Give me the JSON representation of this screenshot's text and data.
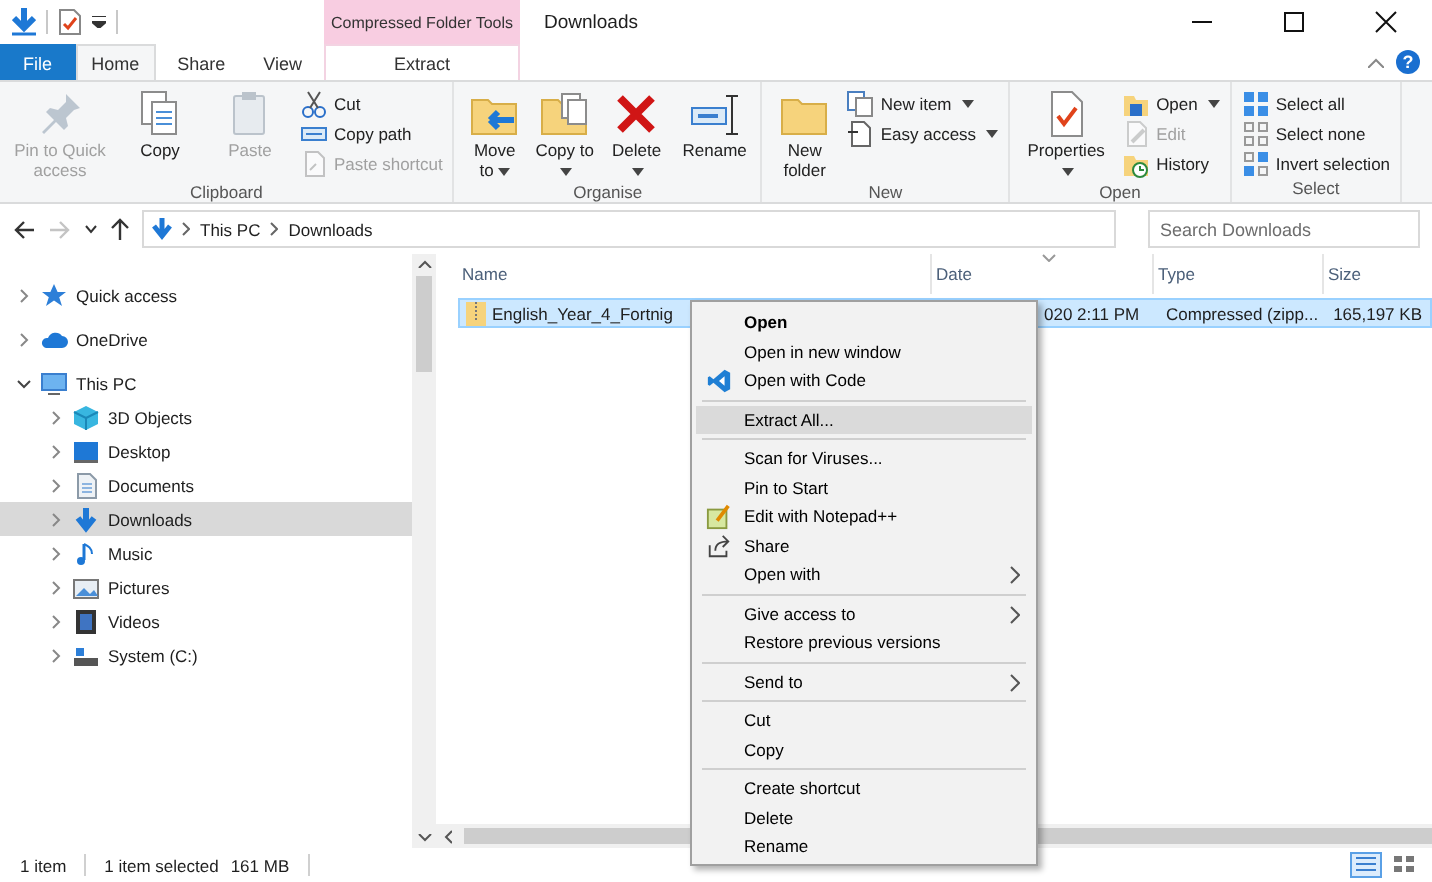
{
  "window": {
    "title": "Downloads",
    "tool_group": "Compressed Folder Tools"
  },
  "ribbon_tabs": [
    {
      "label": "File",
      "kind": "file",
      "selected": false
    },
    {
      "label": "Home",
      "kind": "normal",
      "selected": true
    },
    {
      "label": "Share",
      "kind": "normal",
      "selected": false
    },
    {
      "label": "View",
      "kind": "normal",
      "selected": false
    },
    {
      "label": "Extract",
      "kind": "contextual",
      "selected": false
    }
  ],
  "help_button": "?",
  "ribbon_groups": [
    {
      "label": "Clipboard",
      "buttons": [
        {
          "label": "Pin to Quick access",
          "kind": "large",
          "dropdown": false,
          "disabled": true
        },
        {
          "label": "Copy",
          "kind": "large",
          "dropdown": false,
          "disabled": false
        },
        {
          "label": "Paste",
          "kind": "large",
          "dropdown": false,
          "disabled": true
        },
        {
          "label": "Cut",
          "kind": "small",
          "dropdown": false,
          "disabled": false
        },
        {
          "label": "Copy path",
          "kind": "small",
          "dropdown": false,
          "disabled": false
        },
        {
          "label": "Paste shortcut",
          "kind": "small",
          "dropdown": false,
          "disabled": true
        }
      ]
    },
    {
      "label": "Organise",
      "buttons": [
        {
          "label": "Move to",
          "kind": "large",
          "dropdown": true,
          "disabled": false
        },
        {
          "label": "Copy to",
          "kind": "large",
          "dropdown": true,
          "disabled": false
        },
        {
          "label": "Delete",
          "kind": "large",
          "dropdown": true,
          "disabled": false
        },
        {
          "label": "Rename",
          "kind": "large",
          "dropdown": false,
          "disabled": false
        }
      ]
    },
    {
      "label": "New",
      "buttons": [
        {
          "label": "New folder",
          "kind": "large",
          "dropdown": false,
          "disabled": false
        },
        {
          "label": "New item",
          "kind": "small",
          "dropdown": true,
          "disabled": false
        },
        {
          "label": "Easy access",
          "kind": "small",
          "dropdown": true,
          "disabled": false
        }
      ]
    },
    {
      "label": "Open",
      "buttons": [
        {
          "label": "Properties",
          "kind": "large",
          "dropdown": true,
          "disabled": false
        },
        {
          "label": "Open",
          "kind": "small",
          "dropdown": true,
          "disabled": false
        },
        {
          "label": "Edit",
          "kind": "small",
          "dropdown": false,
          "disabled": true
        },
        {
          "label": "History",
          "kind": "small",
          "dropdown": false,
          "disabled": false
        }
      ]
    },
    {
      "label": "Select",
      "buttons": [
        {
          "label": "Select all",
          "kind": "small",
          "dropdown": false,
          "disabled": false
        },
        {
          "label": "Select none",
          "kind": "small",
          "dropdown": false,
          "disabled": false
        },
        {
          "label": "Invert selection",
          "kind": "small",
          "dropdown": false,
          "disabled": false
        }
      ]
    }
  ],
  "history_buttons": [
    {
      "disabled": false
    },
    {
      "disabled": true
    },
    {
      "disabled": false
    },
    {
      "disabled": false
    }
  ],
  "address_bar": {
    "path": [
      "This PC",
      "Downloads"
    ]
  },
  "search": {
    "placeholder": "Search Downloads"
  },
  "navigation_pane": {
    "items": [
      {
        "label": "Quick access",
        "expanded": false,
        "selected": false
      },
      {
        "label": "OneDrive",
        "expanded": false,
        "selected": false
      },
      {
        "label": "This PC",
        "expanded": true,
        "selected": false,
        "children": [
          {
            "label": "3D Objects",
            "expanded": false,
            "selected": false
          },
          {
            "label": "Desktop",
            "expanded": false,
            "selected": false
          },
          {
            "label": "Documents",
            "expanded": false,
            "selected": false
          },
          {
            "label": "Downloads",
            "expanded": false,
            "selected": true
          },
          {
            "label": "Music",
            "expanded": false,
            "selected": false
          },
          {
            "label": "Pictures",
            "expanded": false,
            "selected": false
          },
          {
            "label": "Videos",
            "expanded": false,
            "selected": false
          },
          {
            "label": "System (C:)",
            "expanded": false,
            "selected": false
          }
        ]
      }
    ]
  },
  "file_list": {
    "columns": [
      "Name",
      "Date",
      "Type",
      "Size"
    ],
    "rows": [
      {
        "name": "English_Year_4_Fortnig",
        "date": "020 2:11 PM",
        "type": "Compressed (zipp...",
        "size": "165,197 KB",
        "selected": true
      }
    ]
  },
  "context_menu": {
    "items": [
      {
        "kind": "item",
        "label": "Open",
        "default": true,
        "highlighted": false,
        "submenu": false
      },
      {
        "kind": "item",
        "label": "Open in new window",
        "default": false,
        "highlighted": false,
        "submenu": false
      },
      {
        "kind": "item",
        "label": "Open with Code",
        "default": false,
        "highlighted": false,
        "submenu": false
      },
      {
        "kind": "separator"
      },
      {
        "kind": "item",
        "label": "Extract All...",
        "default": false,
        "highlighted": true,
        "submenu": false
      },
      {
        "kind": "separator"
      },
      {
        "kind": "item",
        "label": "Scan for Viruses...",
        "default": false,
        "highlighted": false,
        "submenu": false
      },
      {
        "kind": "item",
        "label": "Pin to Start",
        "default": false,
        "highlighted": false,
        "submenu": false
      },
      {
        "kind": "item",
        "label": "Edit with Notepad++",
        "default": false,
        "highlighted": false,
        "submenu": false
      },
      {
        "kind": "item",
        "label": "Share",
        "default": false,
        "highlighted": false,
        "submenu": false
      },
      {
        "kind": "item",
        "label": "Open with",
        "default": false,
        "highlighted": false,
        "submenu": true
      },
      {
        "kind": "separator"
      },
      {
        "kind": "item",
        "label": "Give access to",
        "default": false,
        "highlighted": false,
        "submenu": true
      },
      {
        "kind": "item",
        "label": "Restore previous versions",
        "default": false,
        "highlighted": false,
        "submenu": false
      },
      {
        "kind": "separator"
      },
      {
        "kind": "item",
        "label": "Send to",
        "default": false,
        "highlighted": false,
        "submenu": true
      },
      {
        "kind": "separator"
      },
      {
        "kind": "item",
        "label": "Cut",
        "default": false,
        "highlighted": false,
        "submenu": false
      },
      {
        "kind": "item",
        "label": "Copy",
        "default": false,
        "highlighted": false,
        "submenu": false
      },
      {
        "kind": "separator"
      },
      {
        "kind": "item",
        "label": "Create shortcut",
        "default": false,
        "highlighted": false,
        "submenu": false
      },
      {
        "kind": "item",
        "label": "Delete",
        "default": false,
        "highlighted": false,
        "submenu": false
      },
      {
        "kind": "item",
        "label": "Rename",
        "default": false,
        "highlighted": false,
        "submenu": false
      }
    ]
  },
  "status_bar": {
    "item_count": "1 item",
    "selection": "1 item selected",
    "selection_size": "161 MB",
    "view_buttons": [
      {
        "selected": true
      },
      {
        "selected": false
      }
    ]
  }
}
